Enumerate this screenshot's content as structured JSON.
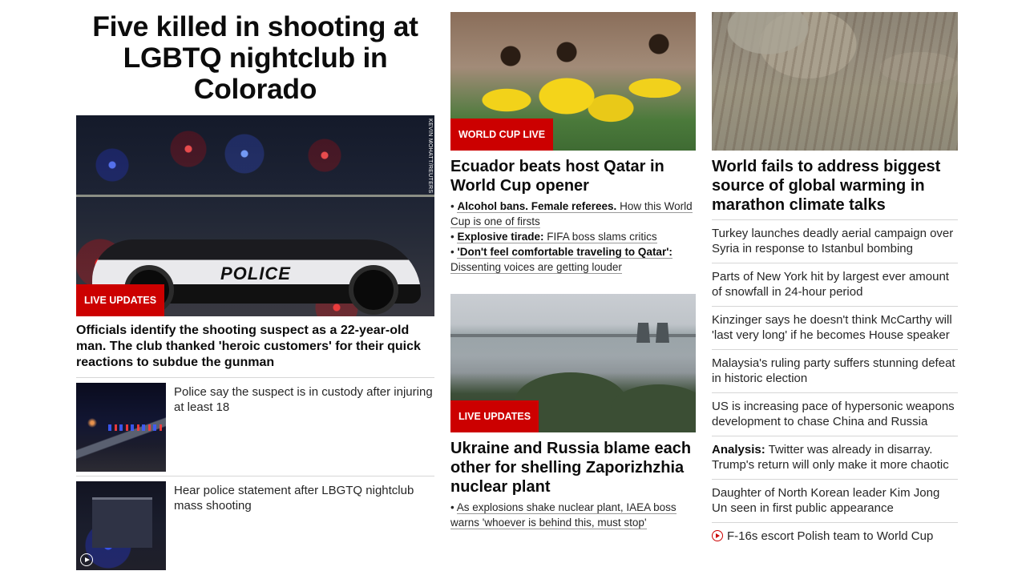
{
  "col1": {
    "headline": "Five killed in shooting at LGBTQ nightclub in Colorado",
    "hero_label": "LIVE UPDATES",
    "photo_credit": "KEVIN MOHATT/REUTERS",
    "car_text": "POLICE",
    "lead": "Officials identify the shooting suspect as a 22-year-old man. The club thanked 'heroic customers' for their quick reactions to subdue the gunman",
    "related": [
      {
        "text": "Police say the suspect is in custody after injuring at least 18"
      },
      {
        "text": "Hear police statement after LBGTQ nightclub mass shooting"
      }
    ]
  },
  "col2": {
    "story1": {
      "label": "WORLD CUP LIVE",
      "headline": "Ecuador beats host Qatar in World Cup opener",
      "bullets": [
        {
          "bold": "Alcohol bans. Female referees.",
          "text": "How this World Cup is one of firsts"
        },
        {
          "bold": "Explosive tirade:",
          "text": "FIFA boss slams critics"
        },
        {
          "bold": "'Don't feel comfortable traveling to Qatar':",
          "text": "Dissenting voices are getting louder"
        }
      ]
    },
    "story2": {
      "label": "LIVE UPDATES",
      "headline": "Ukraine and Russia blame each other for shelling Zaporizhzhia nuclear plant",
      "bullet": "As explosions shake nuclear plant, IAEA boss warns 'whoever is behind this, must stop'"
    }
  },
  "col3": {
    "headline": "World fails to address biggest source of global warming in marathon climate talks",
    "items": [
      {
        "text": "Turkey launches deadly aerial campaign over Syria in response to Istanbul bombing"
      },
      {
        "text": "Parts of New York hit by largest ever amount of snowfall in 24-hour period"
      },
      {
        "text": "Kinzinger says he doesn't think McCarthy will 'last very long' if he becomes House speaker"
      },
      {
        "text": "Malaysia's ruling party suffers stunning defeat in historic election"
      },
      {
        "text": "US is increasing pace of hypersonic weapons development to chase China and Russia"
      },
      {
        "prefix": "Analysis:",
        "text": "Twitter was already in disarray. Trump's return will only make it more chaotic"
      },
      {
        "text": "Daughter of North Korean leader Kim Jong Un seen in first public appearance"
      },
      {
        "text": "F-16s escort Polish team to World Cup"
      }
    ]
  },
  "colors": {
    "accent_red": "#cc0000",
    "text": "#0c0c0c",
    "divider": "#d6d6d6"
  }
}
